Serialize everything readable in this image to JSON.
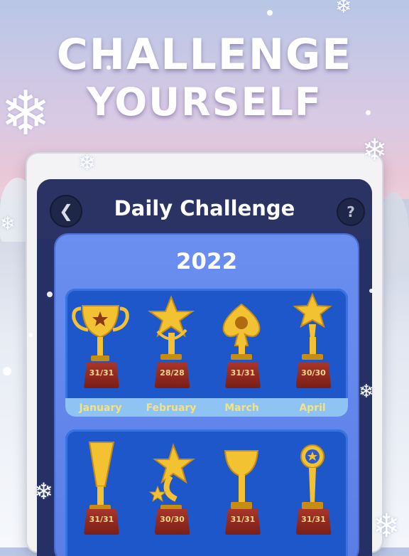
{
  "headline": {
    "line1": "CHALLENGE",
    "line2": "YOURSELF"
  },
  "app": {
    "title": "Daily Challenge",
    "back_icon": "chevron-left-icon",
    "help_label": "?"
  },
  "year": "2022",
  "months": [
    {
      "name": "January",
      "score": "31/31",
      "icon": "cup-trophy-icon"
    },
    {
      "name": "February",
      "score": "28/28",
      "icon": "star-trophy-icon"
    },
    {
      "name": "March",
      "score": "31/31",
      "icon": "spade-trophy-icon"
    },
    {
      "name": "April",
      "score": "30/30",
      "icon": "star-torch-trophy-icon"
    },
    {
      "name": "",
      "score": "31/31",
      "icon": "horn-trophy-icon"
    },
    {
      "name": "",
      "score": "30/30",
      "icon": "shooting-star-trophy-icon"
    },
    {
      "name": "",
      "score": "31/31",
      "icon": "goblet-trophy-icon"
    },
    {
      "name": "",
      "score": "31/31",
      "icon": "medal-trophy-icon"
    }
  ],
  "colors": {
    "gold": "#f3c233",
    "base": "#8f2a20",
    "panel": "#1e57c9",
    "month_label": "#f6e27d"
  }
}
